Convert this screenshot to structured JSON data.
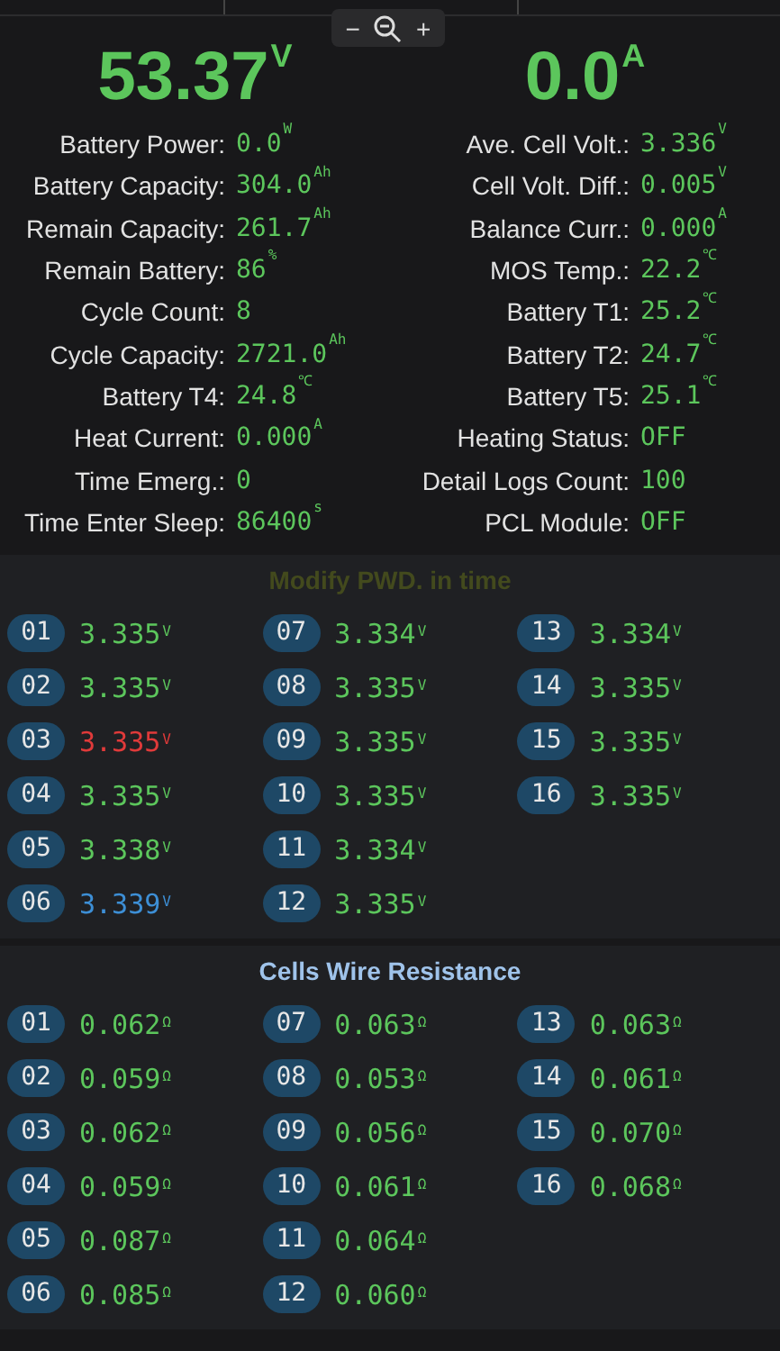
{
  "zoom_control": {
    "minus": "−",
    "plus": "+"
  },
  "summary": [
    {
      "value": "53.37",
      "unit": "V"
    },
    {
      "value": "0.0",
      "unit": "A"
    }
  ],
  "stats": [
    {
      "label": "Battery Power:",
      "value": "0.0",
      "unit": "W"
    },
    {
      "label": "Ave. Cell Volt.:",
      "value": "3.336",
      "unit": "V"
    },
    {
      "label": "Battery Capacity:",
      "value": "304.0",
      "unit": "Ah"
    },
    {
      "label": "Cell Volt. Diff.:",
      "value": "0.005",
      "unit": "V"
    },
    {
      "label": "Remain Capacity:",
      "value": "261.7",
      "unit": "Ah"
    },
    {
      "label": "Balance Curr.:",
      "value": "0.000",
      "unit": "A"
    },
    {
      "label": "Remain Battery:",
      "value": "86",
      "unit": "%"
    },
    {
      "label": "MOS Temp.:",
      "value": "22.2",
      "unit": "℃"
    },
    {
      "label": "Cycle Count:",
      "value": "8"
    },
    {
      "label": "Battery T1:",
      "value": "25.2",
      "unit": "℃"
    },
    {
      "label": "Cycle Capacity:",
      "value": "2721.0",
      "unit": "Ah"
    },
    {
      "label": "Battery T2:",
      "value": "24.7",
      "unit": "℃"
    },
    {
      "label": "Battery T4:",
      "value": "24.8",
      "unit": "℃"
    },
    {
      "label": "Battery T5:",
      "value": "25.1",
      "unit": "℃"
    },
    {
      "label": "Heat Current:",
      "value": "0.000",
      "unit": "A"
    },
    {
      "label": "Heating Status:",
      "value": "OFF"
    },
    {
      "label": "Time Emerg.:",
      "value": "0"
    },
    {
      "label": "Detail Logs Count:",
      "value": "100"
    },
    {
      "label": "Time Enter Sleep:",
      "value": "86400",
      "unit": "s"
    },
    {
      "label": "PCL Module:",
      "value": "OFF"
    }
  ],
  "voltage_section": {
    "title": "Modify PWD. in time",
    "cells": [
      {
        "index": "01",
        "value": "3.335",
        "unit": "V",
        "color": "#5cc65c"
      },
      {
        "index": "02",
        "value": "3.335",
        "unit": "V",
        "color": "#5cc65c"
      },
      {
        "index": "03",
        "value": "3.335",
        "unit": "V",
        "color": "#e03a3a"
      },
      {
        "index": "04",
        "value": "3.335",
        "unit": "V",
        "color": "#5cc65c"
      },
      {
        "index": "05",
        "value": "3.338",
        "unit": "V",
        "color": "#5cc65c"
      },
      {
        "index": "06",
        "value": "3.339",
        "unit": "V",
        "color": "#3d8fd6"
      },
      {
        "index": "07",
        "value": "3.334",
        "unit": "V",
        "color": "#5cc65c"
      },
      {
        "index": "08",
        "value": "3.335",
        "unit": "V",
        "color": "#5cc65c"
      },
      {
        "index": "09",
        "value": "3.335",
        "unit": "V",
        "color": "#5cc65c"
      },
      {
        "index": "10",
        "value": "3.335",
        "unit": "V",
        "color": "#5cc65c"
      },
      {
        "index": "11",
        "value": "3.334",
        "unit": "V",
        "color": "#5cc65c"
      },
      {
        "index": "12",
        "value": "3.335",
        "unit": "V",
        "color": "#5cc65c"
      },
      {
        "index": "13",
        "value": "3.334",
        "unit": "V",
        "color": "#5cc65c"
      },
      {
        "index": "14",
        "value": "3.335",
        "unit": "V",
        "color": "#5cc65c"
      },
      {
        "index": "15",
        "value": "3.335",
        "unit": "V",
        "color": "#5cc65c"
      },
      {
        "index": "16",
        "value": "3.335",
        "unit": "V",
        "color": "#5cc65c"
      }
    ]
  },
  "resistance_section": {
    "title": "Cells Wire Resistance",
    "cells": [
      {
        "index": "01",
        "value": "0.062",
        "unit": "Ω",
        "color": "#5cc65c"
      },
      {
        "index": "02",
        "value": "0.059",
        "unit": "Ω",
        "color": "#5cc65c"
      },
      {
        "index": "03",
        "value": "0.062",
        "unit": "Ω",
        "color": "#5cc65c"
      },
      {
        "index": "04",
        "value": "0.059",
        "unit": "Ω",
        "color": "#5cc65c"
      },
      {
        "index": "05",
        "value": "0.087",
        "unit": "Ω",
        "color": "#5cc65c"
      },
      {
        "index": "06",
        "value": "0.085",
        "unit": "Ω",
        "color": "#5cc65c"
      },
      {
        "index": "07",
        "value": "0.063",
        "unit": "Ω",
        "color": "#5cc65c"
      },
      {
        "index": "08",
        "value": "0.053",
        "unit": "Ω",
        "color": "#5cc65c"
      },
      {
        "index": "09",
        "value": "0.056",
        "unit": "Ω",
        "color": "#5cc65c"
      },
      {
        "index": "10",
        "value": "0.061",
        "unit": "Ω",
        "color": "#5cc65c"
      },
      {
        "index": "11",
        "value": "0.064",
        "unit": "Ω",
        "color": "#5cc65c"
      },
      {
        "index": "12",
        "value": "0.060",
        "unit": "Ω",
        "color": "#5cc65c"
      },
      {
        "index": "13",
        "value": "0.063",
        "unit": "Ω",
        "color": "#5cc65c"
      },
      {
        "index": "14",
        "value": "0.061",
        "unit": "Ω",
        "color": "#5cc65c"
      },
      {
        "index": "15",
        "value": "0.070",
        "unit": "Ω",
        "color": "#5cc65c"
      },
      {
        "index": "16",
        "value": "0.068",
        "unit": "Ω",
        "color": "#5cc65c"
      }
    ]
  }
}
